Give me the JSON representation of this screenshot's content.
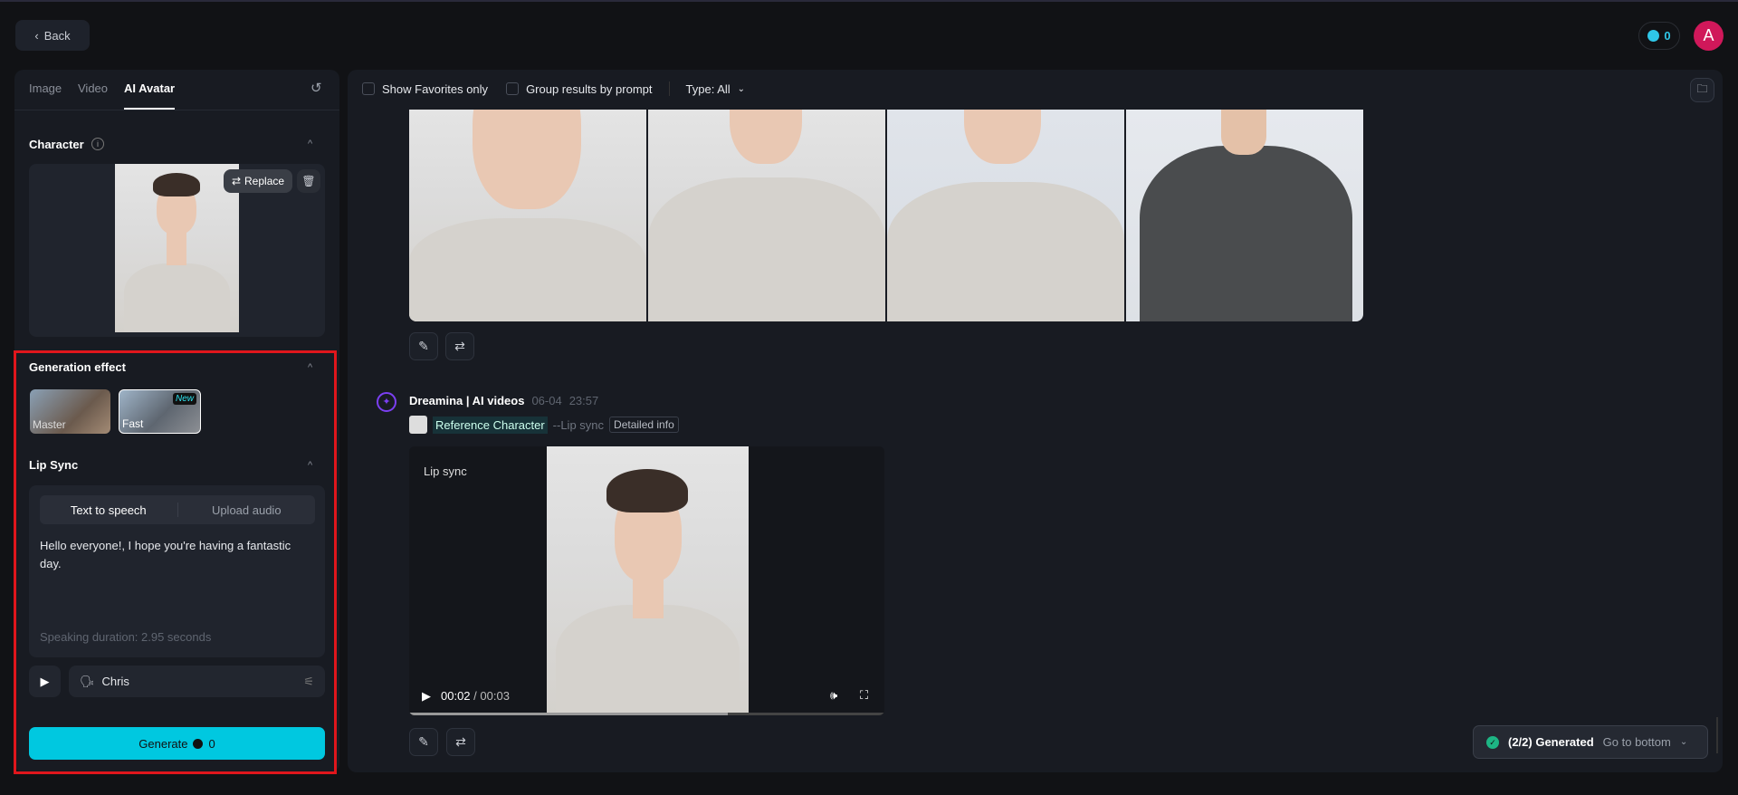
{
  "header": {
    "back_label": "Back",
    "credits": "0",
    "avatar_initial": "A"
  },
  "left": {
    "tabs": [
      {
        "label": "Image"
      },
      {
        "label": "Video"
      },
      {
        "label": "AI Avatar",
        "active": true
      }
    ],
    "character": {
      "title": "Character",
      "replace_label": "Replace"
    },
    "generation_effect": {
      "title": "Generation effect",
      "options": [
        {
          "label": "Master"
        },
        {
          "label": "Fast",
          "badge": "New",
          "selected": true
        }
      ]
    },
    "lip_sync": {
      "title": "Lip Sync",
      "modes": [
        {
          "label": "Text to speech",
          "active": true
        },
        {
          "label": "Upload audio"
        }
      ],
      "text": "Hello everyone!, I hope you're having a fantastic day.",
      "duration": "Speaking duration: 2.95 seconds",
      "voice": "Chris"
    },
    "generate": {
      "label": "Generate",
      "cost": "0"
    }
  },
  "toolbar": {
    "show_favorites": "Show Favorites only",
    "group_results": "Group results by prompt",
    "type_filter": "Type: All"
  },
  "entry": {
    "app": "Dreamina | AI videos",
    "date": "06-04",
    "time": "23:57",
    "ref_label": "Reference Character",
    "mode": "--Lip sync",
    "detail_label": "Detailed info",
    "video": {
      "label": "Lip sync",
      "current": "00:02",
      "total": "00:03",
      "progress": 0.67
    }
  },
  "toast": {
    "status": "(2/2) Generated",
    "action": "Go to bottom"
  },
  "colors": {
    "accent": "#00c8e0",
    "avatar": "#d0185a",
    "success": "#1db584",
    "highlight": "#e0161c"
  }
}
